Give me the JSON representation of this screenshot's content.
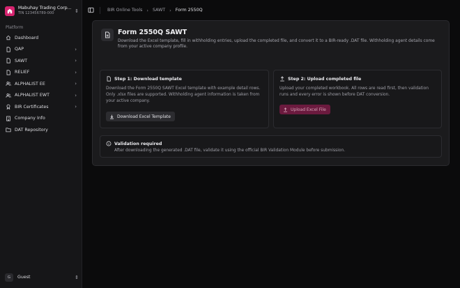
{
  "company": {
    "name": "Mabuhay Trading Corp...",
    "tin": "TIN 123456789-000"
  },
  "sidebar": {
    "group_label": "Platform",
    "items": [
      {
        "label": "Dashboard",
        "icon": "home-icon",
        "expandable": false
      },
      {
        "label": "QAP",
        "icon": "document-icon",
        "expandable": true
      },
      {
        "label": "SAWT",
        "icon": "document-icon",
        "expandable": true
      },
      {
        "label": "RELIEF",
        "icon": "document-icon",
        "expandable": true
      },
      {
        "label": "ALPHALIST EE",
        "icon": "users-icon",
        "expandable": true
      },
      {
        "label": "ALPHALIST EWT",
        "icon": "users-icon",
        "expandable": true
      },
      {
        "label": "BIR Certificates",
        "icon": "certificate-icon",
        "expandable": true
      },
      {
        "label": "Company Info",
        "icon": "building-icon",
        "expandable": false
      },
      {
        "label": "DAT Repository",
        "icon": "folder-icon",
        "expandable": false
      }
    ]
  },
  "user": {
    "initial": "G",
    "name": "Guest"
  },
  "breadcrumb": [
    "BIR Online Tools",
    "SAWT",
    "Form 2550Q"
  ],
  "page": {
    "title": "Form 2550Q SAWT",
    "description": "Download the Excel template, fill in withholding entries, upload the completed file, and convert it to a BIR-ready .DAT file. Withholding agent details come from your active company profile."
  },
  "step1": {
    "title": "Step 1: Download template",
    "text": "Download the Form 2550Q SAWT Excel template with example detail rows. Only .xlsx files are supported. Withholding agent information is taken from your active company.",
    "button": "Download Excel Template"
  },
  "step2": {
    "title": "Step 2: Upload completed file",
    "text": "Upload your completed workbook. All rows are read first, then validation runs and every error is shown before DAT conversion.",
    "button": "Upload Excel File"
  },
  "validation": {
    "title": "Validation required",
    "text": "After downloading the generated .DAT file, validate it using the official BIR Validation Module before submission."
  },
  "colors": {
    "accent": "#d6246f",
    "upload_button_bg": "#6b1a3e",
    "background": "#0b0b0c",
    "card": "#1b1b1d"
  }
}
